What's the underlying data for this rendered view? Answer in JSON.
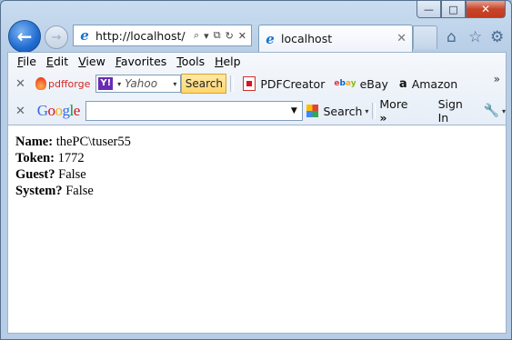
{
  "window": {
    "minimize": "—",
    "maximize": "□",
    "close": "✕"
  },
  "address_bar": {
    "url": "http://localhost/",
    "search_icon": "⌕",
    "dropdown_icon": "▾",
    "compat_icon": "⧉",
    "refresh_icon": "↻",
    "stop_icon": "✕"
  },
  "tab": {
    "title": "localhost",
    "close": "✕"
  },
  "right_icons": {
    "home": "⌂",
    "favorites": "☆",
    "tools": "⚙"
  },
  "menu": [
    {
      "u": "F",
      "rest": "ile"
    },
    {
      "u": "E",
      "rest": "dit"
    },
    {
      "u": "V",
      "rest": "iew"
    },
    {
      "u": "F",
      "rest": "avorites"
    },
    {
      "u": "T",
      "rest": "ools"
    },
    {
      "u": "H",
      "rest": "elp"
    }
  ],
  "toolbar1": {
    "pdfforge": "pdfforge",
    "yahoo_logo": "Y!",
    "yahoo_placeholder": "Yahoo",
    "search_button": "Search",
    "pdfcreator": "PDFCreator",
    "ebay": "eBay",
    "amazon": "Amazon",
    "more_chevron": "»"
  },
  "toolbar2": {
    "google_logo": [
      {
        "c": "G",
        "color": "#3369e8"
      },
      {
        "c": "o",
        "color": "#d50f25"
      },
      {
        "c": "o",
        "color": "#eeb211"
      },
      {
        "c": "g",
        "color": "#3369e8"
      },
      {
        "c": "l",
        "color": "#009925"
      },
      {
        "c": "e",
        "color": "#d50f25"
      }
    ],
    "search": "Search",
    "more": "More",
    "more_icon": "»",
    "sign_in": "Sign In"
  },
  "content": [
    {
      "label": "Name:",
      "value": " thePC\\tuser55"
    },
    {
      "label": "Token:",
      "value": " 1772"
    },
    {
      "label": "Guest?",
      "value": " False"
    },
    {
      "label": "System?",
      "value": " False"
    }
  ]
}
